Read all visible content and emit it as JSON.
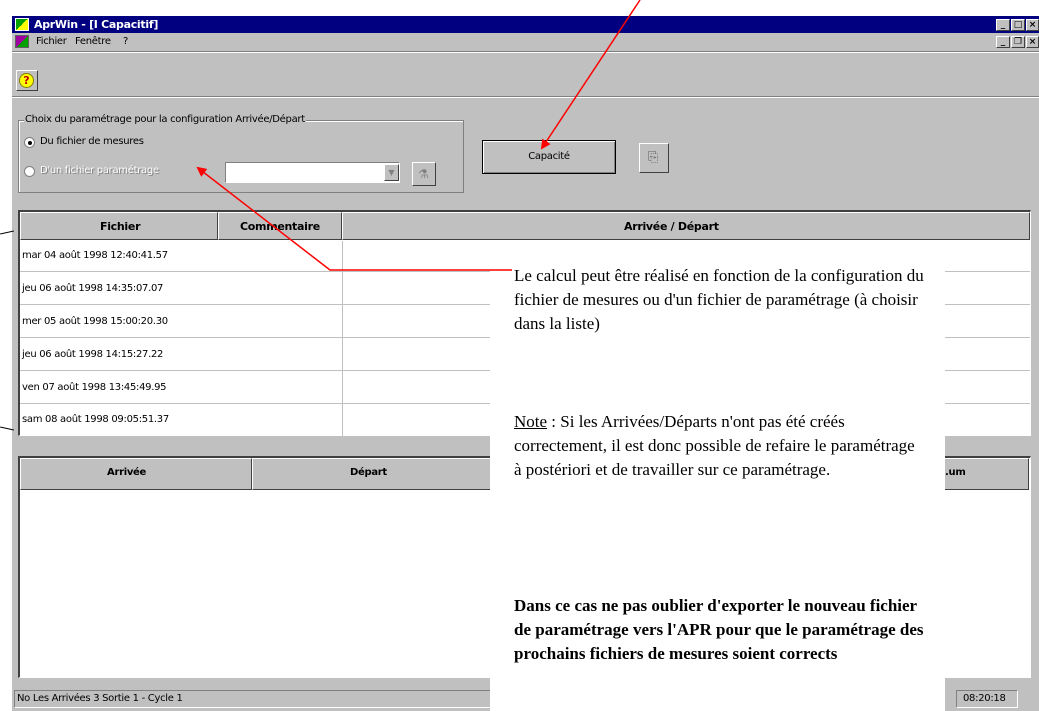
{
  "window": {
    "title": "AprWin - [I Capacitif]",
    "menu": [
      "Fichier",
      "Fenêtre",
      "?"
    ]
  },
  "toolbar": {
    "help_icon": "?"
  },
  "group": {
    "legend": "Choix du paramétrage pour la configuration Arrivée/Départ",
    "option_measures": "Du fichier de mesures",
    "option_param": "D'un fichier paramétrage",
    "param_value": ""
  },
  "buttons": {
    "calc": "Capacité"
  },
  "upper_table": {
    "headers": [
      "Fichier",
      "Commentaire",
      "Arrivée / Départ"
    ],
    "rows": [
      "mar 04 août 1998 12:40:41.57",
      "jeu 06 août 1998 14:35:07.07",
      "mer 05 août 1998 15:00:20.30",
      "jeu 06 août 1998 14:15:27.22",
      "ven 07 août 1998 13:45:49.95",
      "sam 08 août 1998 09:05:51.37"
    ]
  },
  "lower_table": {
    "headers": [
      "Arrivée",
      "Départ",
      "...um"
    ]
  },
  "status": {
    "left": "No Les Arrivées 3 Sortie 1 - Cycle 1",
    "right": "08:20:18"
  },
  "annotation": {
    "p1": "Le calcul peut être réalisé en fonction de la configuration du fichier de mesures ou d'un fichier de paramétrage (à choisir dans la liste)",
    "note_label": "Note",
    "note_text": " : Si les Arrivées/Départs n'ont pas été créés correctement, il est donc possible de refaire le paramétrage à postériori et de travailler sur ce paramétrage.",
    "bold": "Dans ce cas ne pas oublier d'exporter le nouveau fichier de paramétrage vers l'APR pour que le paramétrage des prochains fichiers de mesures soient corrects"
  },
  "colors": {
    "titlebar": "#000080",
    "face": "#c0c0c0",
    "arrow": "#ff0000"
  }
}
